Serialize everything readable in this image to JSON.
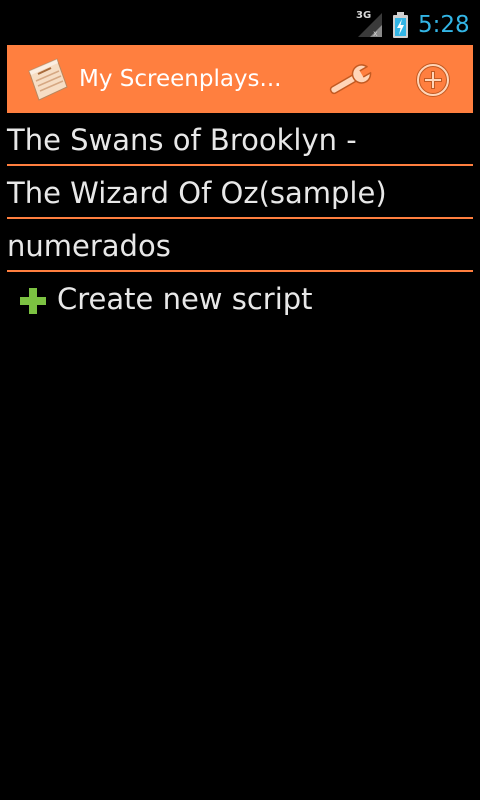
{
  "status_bar": {
    "network_type": "3G",
    "time": "5:28"
  },
  "action_bar": {
    "title": "My Screenplays...",
    "app_icon": "screenplay-document-icon",
    "settings_icon": "wrench-icon",
    "add_icon": "add-circle-icon"
  },
  "scripts": [
    {
      "title": "The Swans of Brooklyn -"
    },
    {
      "title": "The Wizard Of Oz(sample)"
    },
    {
      "title": "numerados"
    }
  ],
  "create_new": {
    "label": "Create new script",
    "icon": "plus-icon"
  },
  "colors": {
    "accent": "#ff7f3f",
    "clock": "#33b5e5",
    "plus": "#7cc242",
    "background": "#000000",
    "text": "#e8e8e8"
  }
}
